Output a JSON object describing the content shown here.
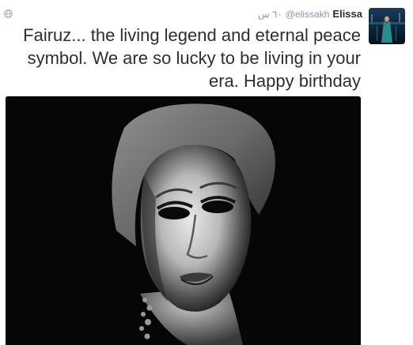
{
  "tweet": {
    "display_name": "Elissa",
    "handle": "@elissakh",
    "timestamp": "٦٠ س",
    "text": "Fairuz... the living legend and eternal peace symbol. We are so lucky to be living in your era. Happy birthday"
  },
  "icons": {
    "globe": "globe-icon",
    "avatar": "avatar"
  },
  "colors": {
    "name": "#292f33",
    "meta": "#8899a6",
    "photo_bg": "#050505"
  }
}
